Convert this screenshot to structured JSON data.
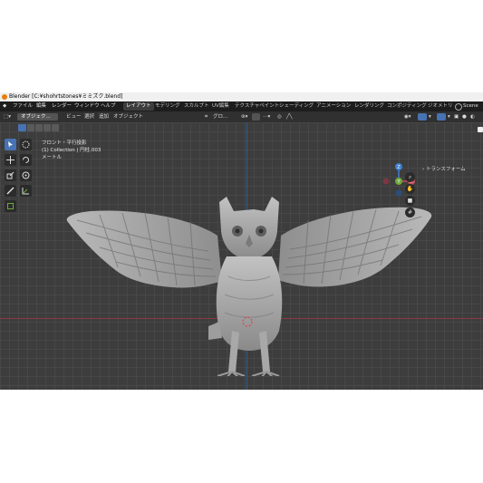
{
  "window": {
    "title": "Blender [C:¥shohrtstones¥ミミズク.blend]"
  },
  "menu": {
    "items": [
      "ファイル",
      "編集",
      "レンダー",
      "ウィンドウ",
      "ヘルプ"
    ]
  },
  "workspaces": {
    "active": "レイアウト",
    "tabs": [
      "レイアウト",
      "モデリング",
      "スカルプト",
      "UV編集",
      "テクスチャペイント",
      "シェーディング",
      "アニメーション",
      "レンダリング",
      "コンポジティング",
      "ジオメトリ"
    ]
  },
  "scene": {
    "label": "Scene"
  },
  "header": {
    "mode": "オブジェク...",
    "view": "ビュー",
    "select": "選択",
    "add": "追加",
    "object": "オブジェクト",
    "orientation": "グロ..."
  },
  "viewport": {
    "view_name": "フロント・平行投影",
    "collection": "(1) Collection | 円柱.003",
    "unit": "メートル"
  },
  "npanel": {
    "label": "トランスフォーム"
  },
  "colors": {
    "accent": "#4772b3",
    "x_axis": "#c94a5a",
    "y_axis": "#6ea93a",
    "z_axis": "#3f7fd0"
  },
  "gizmo": {
    "x_label": "X",
    "y_label": "Y",
    "z_label": "Z"
  },
  "icons": [
    "select-icon",
    "cursor-icon",
    "move-icon",
    "rotate-icon",
    "scale-icon",
    "transform-icon",
    "annotate-icon",
    "measure-icon",
    "add-cube-icon",
    "zoom-icon",
    "pan-icon",
    "camera-icon",
    "grid-icon"
  ]
}
